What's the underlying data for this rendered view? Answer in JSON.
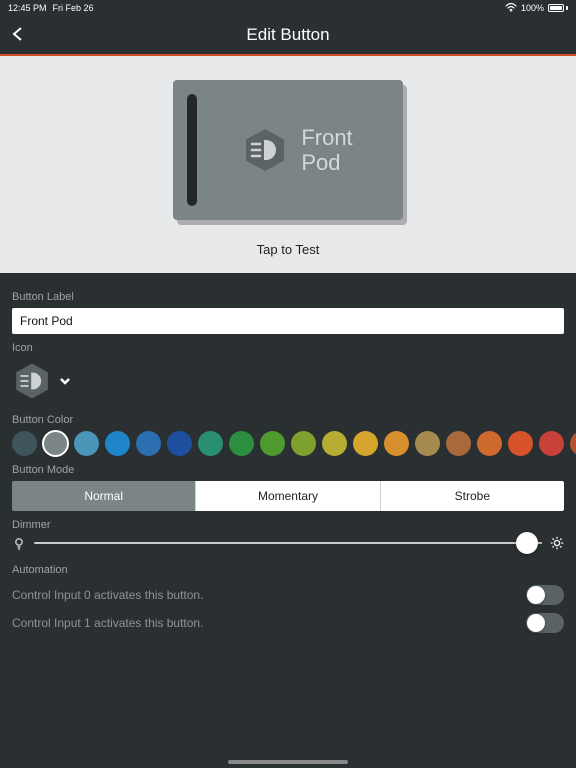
{
  "status": {
    "time": "12:45 PM",
    "date": "Fri Feb 26",
    "battery": "100%"
  },
  "nav": {
    "title": "Edit Button"
  },
  "preview": {
    "line1": "Front",
    "line2": "Pod",
    "tap_label": "Tap to Test"
  },
  "labels": {
    "button_label": "Button Label",
    "icon": "Icon",
    "button_color": "Button Color",
    "button_mode": "Button Mode",
    "dimmer": "Dimmer",
    "automation": "Automation"
  },
  "fields": {
    "button_label_value": "Front Pod"
  },
  "colors": [
    "#3f555c",
    "#7b8487",
    "#4a96b8",
    "#1f85c8",
    "#2b6fb0",
    "#1d4f9e",
    "#2a8f70",
    "#2c8f3f",
    "#4f9a2e",
    "#7fa02f",
    "#b8ad33",
    "#d6a52e",
    "#d78f2e",
    "#a48a4f",
    "#a86a3a",
    "#cf6a2f",
    "#d6532c",
    "#c9423a",
    "#b5522f"
  ],
  "selected_color_index": 1,
  "modes": {
    "options": [
      "Normal",
      "Momentary",
      "Strobe"
    ],
    "selected": 0
  },
  "dimmer": {
    "value_pct": 97
  },
  "automation": {
    "rows": [
      {
        "text": "Control Input 0 activates this button.",
        "on": false
      },
      {
        "text": "Control Input 1 activates this button.",
        "on": false
      }
    ]
  }
}
